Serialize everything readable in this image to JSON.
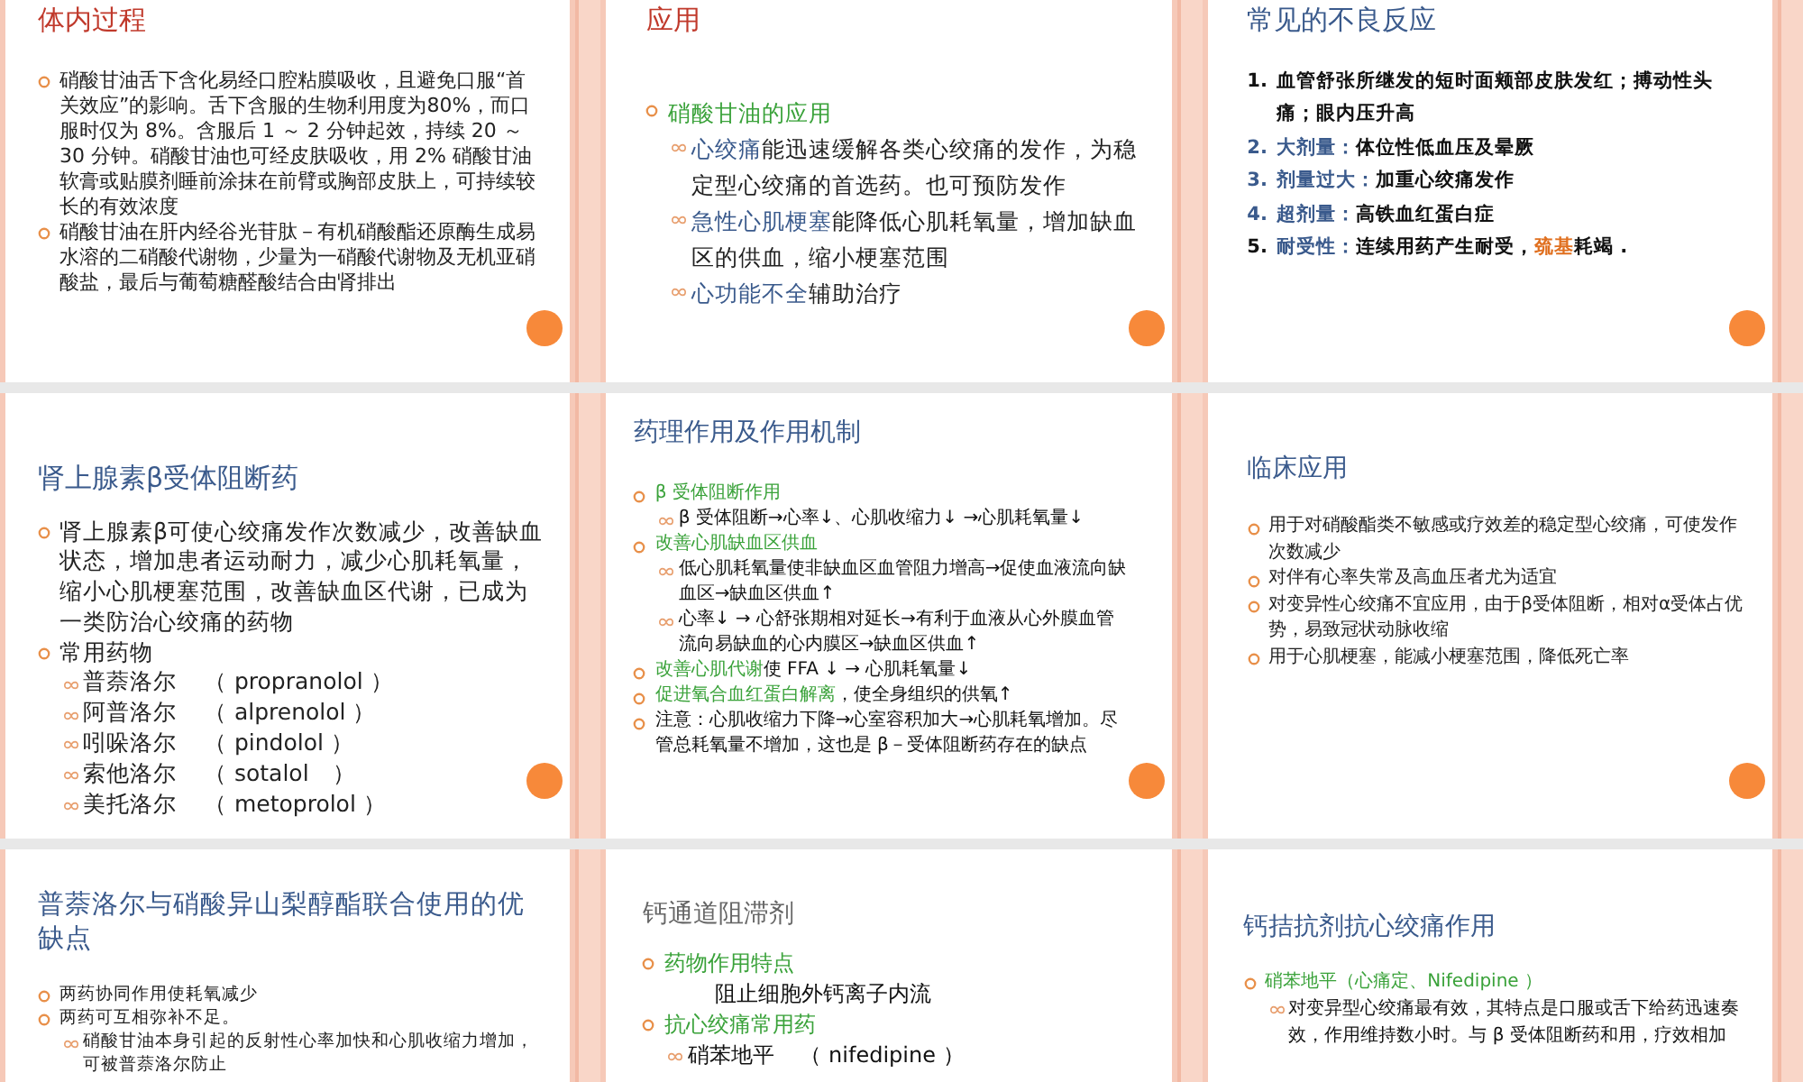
{
  "slides": [
    {
      "title": "体内过程",
      "color": "#c0392b",
      "items": [
        {
          "kind": "bullet",
          "segments": [
            {
              "text": "硝酸甘油舌下含化易经口腔粘膜吸收，且避免口服“首关效应”的影响。舌下含服的生物利用度为80%，而口服时仅为 8%。含服后 1 ～ 2 分钟起效，持续 20 ～ 30 分钟。硝酸甘油也可经皮肤吸收，用 2% 硝酸甘油软膏或贴膜剂睡前涂抹在前臂或胸部皮肤上，可持续较长的有效浓度",
              "color": "#222222"
            }
          ]
        },
        {
          "kind": "bullet",
          "segments": [
            {
              "text": "硝酸甘油在肝内经谷光苷肽－有机硝酸酯还原酶生成易水溶的二硝酸代谢物，少量为一硝酸代谢物及无机亚硝酸盐，最后与葡萄糖醛酸结合由肾排出",
              "color": "#222222"
            }
          ]
        }
      ]
    },
    {
      "title": "应用",
      "color": "#c0392b",
      "items": [
        {
          "kind": "bullet",
          "segments": [
            {
              "text": "硝酸甘油的应用",
              "color": "#3aa23a"
            }
          ]
        },
        {
          "kind": "sub",
          "segments": [
            {
              "text": "心绞痛",
              "color": "#3a5a8c"
            },
            {
              "text": "能迅速缓解各类心绞痛的发作，为稳定型心绞痛的首选药。也可预防发作",
              "color": "#222222"
            }
          ]
        },
        {
          "kind": "sub",
          "segments": [
            {
              "text": "急性心肌梗塞",
              "color": "#3a5a8c"
            },
            {
              "text": "能降低心肌耗氧量，增加缺血区的供血，缩小梗塞范围",
              "color": "#222222"
            }
          ]
        },
        {
          "kind": "sub",
          "segments": [
            {
              "text": "心功能不全",
              "color": "#3a5a8c"
            },
            {
              "text": "辅助治疗",
              "color": "#222222"
            }
          ]
        }
      ]
    },
    {
      "title": "常见的不良反应",
      "color": "#3a5a8c",
      "items": [
        {
          "kind": "num",
          "marker": {
            "text": "1.",
            "color": "#111111"
          },
          "segments": [
            {
              "text": "血管舒张所继发的短时面颊部皮肤发红；搏动性头痛；眼内压升高",
              "color": "#111111"
            }
          ]
        },
        {
          "kind": "num",
          "marker": {
            "text": "2.",
            "color": "#3a5a8c"
          },
          "segments": [
            {
              "text": "大剂量：",
              "color": "#3a5a8c"
            },
            {
              "text": "体位性低血压及晕厥",
              "color": "#111111"
            }
          ]
        },
        {
          "kind": "num",
          "marker": {
            "text": "3.",
            "color": "#3a5a8c"
          },
          "segments": [
            {
              "text": "剂量过大：",
              "color": "#3a5a8c"
            },
            {
              "text": "加重心绞痛发作",
              "color": "#111111"
            }
          ]
        },
        {
          "kind": "num",
          "marker": {
            "text": "4.",
            "color": "#3a5a8c"
          },
          "segments": [
            {
              "text": "超剂量：",
              "color": "#3a5a8c"
            },
            {
              "text": "高铁血红蛋白症",
              "color": "#111111"
            }
          ]
        },
        {
          "kind": "num",
          "marker": {
            "text": "5.",
            "color": "#111111"
          },
          "segments": [
            {
              "text": "耐受性：",
              "color": "#3a5a8c"
            },
            {
              "text": "连续用药产生耐受，",
              "color": "#111111"
            },
            {
              "text": "巯基",
              "color": "#e07020"
            },
            {
              "text": "耗竭 .",
              "color": "#111111"
            }
          ]
        }
      ]
    },
    {
      "title": "肾上腺素β受体阻断药",
      "color": "#3a5a8c",
      "items": [
        {
          "kind": "bullet",
          "segments": [
            {
              "text": "肾上腺素β可使心绞痛发作次数减少，改善缺血状态，增加患者运动耐力，减少心肌耗氧量，缩小心肌梗塞范围，改善缺血区代谢，已成为一类防治心绞痛的药物",
              "color": "#222222"
            }
          ]
        },
        {
          "kind": "bullet",
          "segments": [
            {
              "text": "常用药物",
              "color": "#222222"
            }
          ]
        },
        {
          "kind": "sub",
          "segments": [
            {
              "text": "普萘洛尔",
              "color": "#222222"
            },
            {
              "text": "（ propranolol ）",
              "color": "#222222"
            }
          ]
        },
        {
          "kind": "sub",
          "segments": [
            {
              "text": "阿普洛尔",
              "color": "#222222"
            },
            {
              "text": "（ alprenolol ）",
              "color": "#222222"
            }
          ]
        },
        {
          "kind": "sub",
          "segments": [
            {
              "text": "吲哚洛尔",
              "color": "#222222"
            },
            {
              "text": "（ pindolol ）",
              "color": "#222222"
            }
          ]
        },
        {
          "kind": "sub",
          "segments": [
            {
              "text": "索他洛尔",
              "color": "#222222"
            },
            {
              "text": "（ sotalol　）",
              "color": "#222222"
            }
          ]
        },
        {
          "kind": "sub",
          "segments": [
            {
              "text": "美托洛尔",
              "color": "#222222"
            },
            {
              "text": "（ metoprolol ）",
              "color": "#222222"
            }
          ]
        }
      ]
    },
    {
      "title": "药理作用及作用机制",
      "color": "#3a5a8c",
      "items": [
        {
          "kind": "bullet",
          "segments": [
            {
              "text": "β 受体阻断作用",
              "color": "#3aa23a"
            }
          ]
        },
        {
          "kind": "sub",
          "segments": [
            {
              "text": "β 受体阻断→心率↓、心肌收缩力↓ →心肌耗氧量↓",
              "color": "#111111"
            }
          ]
        },
        {
          "kind": "bullet",
          "segments": [
            {
              "text": "改善心肌缺血区供血",
              "color": "#3aa23a"
            }
          ]
        },
        {
          "kind": "sub",
          "segments": [
            {
              "text": "低心肌耗氧量使非缺血区血管阻力增高→促使血液流向缺血区→缺血区供血↑",
              "color": "#111111"
            }
          ]
        },
        {
          "kind": "sub",
          "segments": [
            {
              "text": "心率↓ → 心舒张期相对延长→有利于血液从心外膜血管流向易缺血的心内膜区→缺血区供血↑",
              "color": "#111111"
            }
          ]
        },
        {
          "kind": "bullet",
          "segments": [
            {
              "text": "改善心肌代谢",
              "color": "#3aa23a"
            },
            {
              "text": "使 FFA ↓ → 心肌耗氧量↓",
              "color": "#111111"
            }
          ]
        },
        {
          "kind": "bullet",
          "segments": [
            {
              "text": "促进氧合血红蛋白解离",
              "color": "#3aa23a"
            },
            {
              "text": "，使全身组织的供氧↑",
              "color": "#111111"
            }
          ]
        },
        {
          "kind": "bullet",
          "segments": [
            {
              "text": "注意：心肌收缩力下降→心室容积加大→心肌耗氧增加。尽管总耗氧量不增加，这也是 β－受体阻断药存在的缺点",
              "color": "#111111"
            }
          ]
        }
      ]
    },
    {
      "title": "临床应用",
      "color": "#3a5a8c",
      "items": [
        {
          "kind": "bullet",
          "segments": [
            {
              "text": "用于对硝酸酯类不敏感或疗效差的稳定型心绞痛，可使发作次数减少",
              "color": "#222222"
            }
          ]
        },
        {
          "kind": "bullet",
          "segments": [
            {
              "text": "对伴有心率失常及高血压者尤为适宜",
              "color": "#222222"
            }
          ]
        },
        {
          "kind": "bullet",
          "segments": [
            {
              "text": "对变异性心绞痛不宜应用，由于β受体阻断，相对α受体占优势，易致冠状动脉收缩",
              "color": "#222222"
            }
          ]
        },
        {
          "kind": "bullet",
          "segments": [
            {
              "text": "用于心肌梗塞，能减小梗塞范围，降低死亡率",
              "color": "#222222"
            }
          ]
        }
      ]
    },
    {
      "title": "普萘洛尔与硝酸异山梨醇酯联合使用的优缺点",
      "color": "#3a5a8c",
      "items": [
        {
          "kind": "bullet",
          "segments": [
            {
              "text": "两药协同作用使耗氧减少",
              "color": "#222222"
            }
          ]
        },
        {
          "kind": "bullet",
          "segments": [
            {
              "text": "两药可互相弥补不足。",
              "color": "#222222"
            }
          ]
        },
        {
          "kind": "sub",
          "segments": [
            {
              "text": "硝酸甘油本身引起的反射性心率加快和心肌收缩力增加，可被普萘洛尔防止",
              "color": "#222222"
            }
          ]
        }
      ]
    },
    {
      "title": "钙通道阻滞剂",
      "color": "#666666",
      "items": [
        {
          "kind": "bullet",
          "segments": [
            {
              "text": "药物作用特点",
              "color": "#3aa23a"
            }
          ]
        },
        {
          "kind": "plain",
          "segments": [
            {
              "text": "阻止细胞外钙离子内流",
              "color": "#111111"
            }
          ]
        },
        {
          "kind": "bullet",
          "segments": [
            {
              "text": "抗心绞痛常用药",
              "color": "#3aa23a"
            }
          ]
        },
        {
          "kind": "sub",
          "segments": [
            {
              "text": "硝苯地平",
              "color": "#111111"
            },
            {
              "text": "（ nifedipine ）",
              "color": "#111111"
            }
          ]
        }
      ]
    },
    {
      "title": "钙拮抗剂抗心绞痛作用",
      "color": "#3a5a8c",
      "items": [
        {
          "kind": "bullet",
          "segments": [
            {
              "text": "硝苯地平（心痛定、Nifedipine ）",
              "color": "#3aa23a"
            }
          ]
        },
        {
          "kind": "sub",
          "segments": [
            {
              "text": "对变异型心绞痛最有效，其特点是口服或舌下给药迅速奏效，作用维持数小时。与 β 受体阻断药和用，疗效相加",
              "color": "#111111"
            }
          ]
        }
      ]
    }
  ]
}
